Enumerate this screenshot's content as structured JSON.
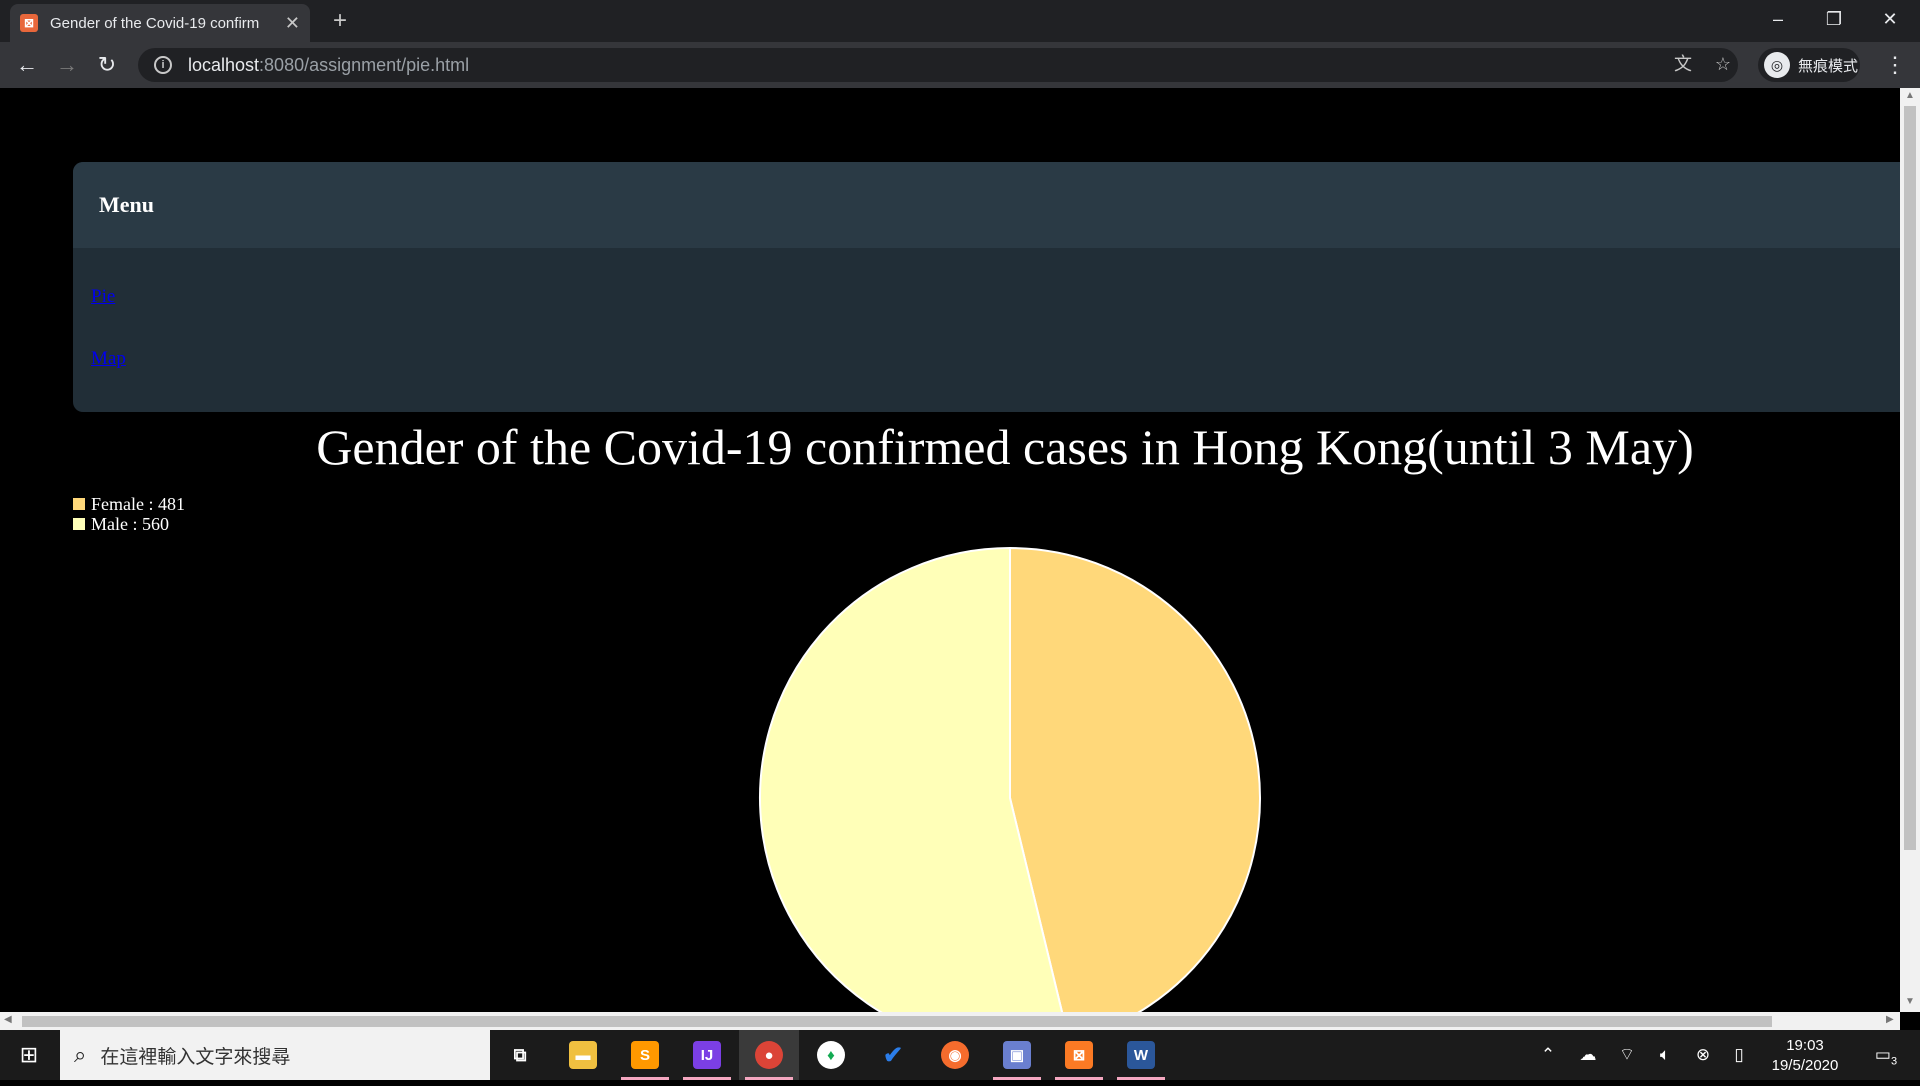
{
  "browser": {
    "tab_title": "Gender of the Covid-19 confirm",
    "tab_favicon": "xampp-icon",
    "url_host": "localhost",
    "url_rest": ":8080/assignment/pie.html",
    "incognito_label": "無痕模式"
  },
  "page": {
    "menu_title": "Menu",
    "menu_items": [
      "Pie",
      "Map"
    ],
    "chart_title": "Gender of the Covid-19 confirmed cases in Hong Kong(until 3 May)"
  },
  "chart_data": {
    "type": "pie",
    "title": "Gender of the Covid-19 confirmed cases in Hong Kong(until 3 May)",
    "categories": [
      "Female",
      "Male"
    ],
    "values": [
      481,
      560
    ],
    "colors": [
      "#ffd87a",
      "#ffffb8"
    ],
    "legend_labels": [
      "Female : 481",
      "Male : 560"
    ],
    "legend_position": "top-left"
  },
  "taskbar": {
    "search_placeholder": "在這裡輸入文字來搜尋",
    "time": "19:03",
    "date": "19/5/2020",
    "notification_count": "3"
  }
}
